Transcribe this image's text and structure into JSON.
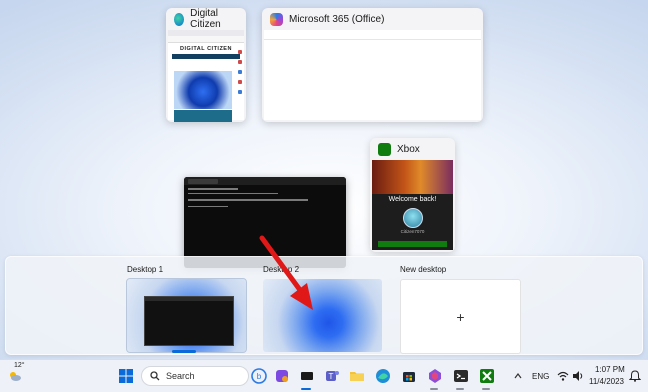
{
  "windows": {
    "digital_citizen": {
      "title": "Digital Citizen",
      "brand": "DIGITAL CITIZEN",
      "icon": "digital-citizen-icon"
    },
    "microsoft365": {
      "title": "Microsoft 365 (Office)",
      "icon": "microsoft-365-icon"
    },
    "xbox": {
      "title": "Xbox",
      "welcome": "Welcome back!",
      "gamertag": "Citizen7070",
      "icon": "xbox-icon"
    },
    "terminal": {
      "icon": "terminal-icon"
    }
  },
  "desktops": {
    "items": [
      {
        "label": "Desktop 1"
      },
      {
        "label": "Desktop 2"
      }
    ],
    "new_label": "New desktop",
    "new_symbol": "+"
  },
  "taskbar": {
    "weather": "12°",
    "search_placeholder": "Search",
    "language": "ENG",
    "time": "1:07 PM",
    "date": "11/4/2023"
  },
  "colors": {
    "accent": "#0b6ad9",
    "xbox_green": "#107c10",
    "arrow_red": "#e01818"
  }
}
